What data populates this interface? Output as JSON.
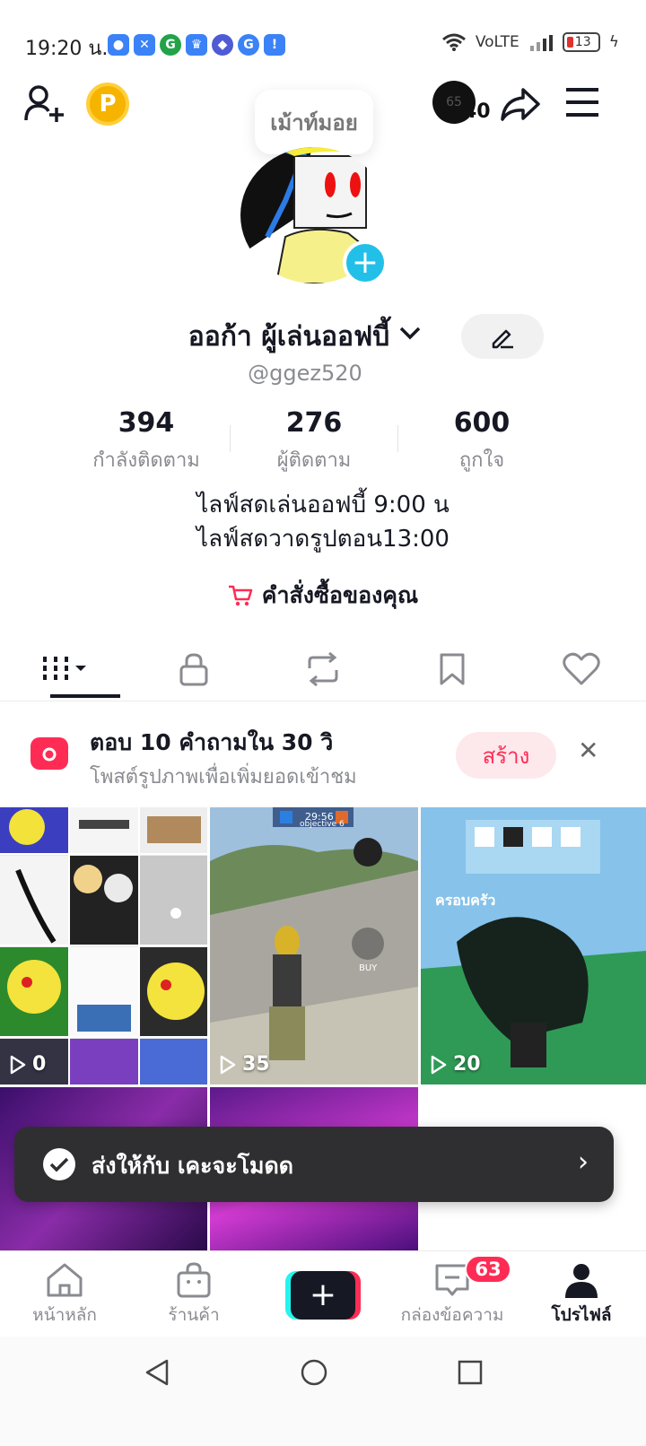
{
  "status_bar": {
    "time": "19:20 น.",
    "network": "VoLTE",
    "battery": "13"
  },
  "top_bar": {
    "coin_letter": "P",
    "nickname_bubble": "เม้าท์มอย",
    "visitor_avatar_text": "65",
    "visitor_count": "40"
  },
  "profile": {
    "display_name": "ออก้า ผู้เล่นออฟบี้",
    "username": "@ggez520",
    "stats": [
      {
        "value": "394",
        "label": "กำลังติดตาม"
      },
      {
        "value": "276",
        "label": "ผู้ติดตาม"
      },
      {
        "value": "600",
        "label": "ถูกใจ"
      }
    ],
    "bio_lines": [
      "ไลฟ์สดเล่นออฟบี้ 9:00 น",
      "ไลฟ์สดวาดรูปตอน13:00"
    ],
    "orders_label": "คำสั่งซื้อของคุณ"
  },
  "banner": {
    "title": "ตอบ 10 คำถามใน 30 วิ",
    "subtitle": "โพสต์รูปภาพเพื่อเพิ่มยอดเข้าชม",
    "create_label": "สร้าง"
  },
  "videos": [
    {
      "views": "0"
    },
    {
      "views": "35"
    },
    {
      "views": "20"
    }
  ],
  "video_overlays": {
    "game_score": "29:56",
    "game_objective": "objective 6",
    "shop_label": "BUY",
    "thumb_text": "ครอบครัว"
  },
  "toast": {
    "text": "ส่งให้กับ เคะจะโมดด"
  },
  "bottom_nav": {
    "home": "หน้าหลัก",
    "shop": "ร้านค้า",
    "inbox": "กล่องข้อความ",
    "inbox_badge": "63",
    "profile": "โปรไฟล์"
  },
  "colors": {
    "accent": "#fe2c55",
    "cyan": "#25f4ee",
    "avatar_add": "#22c0e8",
    "coin": "#f6b400"
  }
}
